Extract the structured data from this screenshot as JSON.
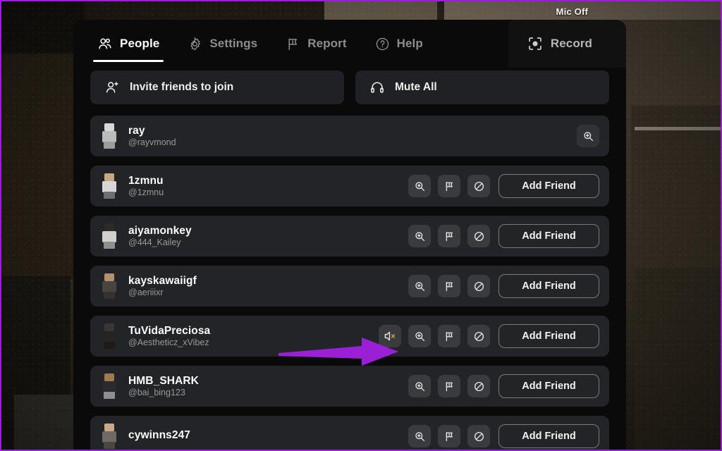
{
  "overlay": {
    "mic_status": "Mic Off",
    "annotation_arrow_color": "#9b1fd4",
    "border_color": "#9b1fd4"
  },
  "tabs": [
    {
      "label": "People",
      "icon": "people-icon",
      "active": true
    },
    {
      "label": "Settings",
      "icon": "gear-icon",
      "active": false
    },
    {
      "label": "Report",
      "icon": "flag-icon",
      "active": false
    },
    {
      "label": "Help",
      "icon": "question-icon",
      "active": false
    },
    {
      "label": "Record",
      "icon": "record-icon",
      "active": false
    }
  ],
  "actions": [
    {
      "label": "Invite friends to join",
      "icon": "person-add-icon"
    },
    {
      "label": "Mute All",
      "icon": "headset-icon"
    }
  ],
  "buttons": {
    "add_friend": "Add Friend"
  },
  "icons": {
    "inspect": "magnifier-plus-icon",
    "report": "flag-icon",
    "block": "block-icon",
    "mute": "speaker-mute-icon"
  },
  "players": [
    {
      "display_name": "ray",
      "username": "@rayvmond",
      "is_self": true,
      "has_mute": false,
      "has_add_friend": false,
      "avatar": {
        "head": "#d8d8d8",
        "body": "#b9bbbd",
        "legs": "#9a9c9e"
      }
    },
    {
      "display_name": "1zmnu",
      "username": "@1zmnu",
      "is_self": false,
      "has_mute": false,
      "has_add_friend": true,
      "avatar": {
        "head": "#c8a87c",
        "body": "#d6d6d6",
        "legs": "#6e6e6e"
      }
    },
    {
      "display_name": "aiyamonkey",
      "username": "@444_Kailey",
      "is_self": false,
      "has_mute": false,
      "has_add_friend": true,
      "avatar": {
        "head": "#2e2a26",
        "body": "#cfcfcf",
        "legs": "#8e8e8e"
      }
    },
    {
      "display_name": "kayskawaiigf",
      "username": "@aeriiixr",
      "is_self": false,
      "has_mute": false,
      "has_add_friend": true,
      "avatar": {
        "head": "#b59070",
        "body": "#4a4440",
        "legs": "#35312e"
      }
    },
    {
      "display_name": "TuVidaPreciosa",
      "username": "@Aestheticz_xVibez",
      "is_self": false,
      "has_mute": true,
      "has_add_friend": true,
      "avatar": {
        "head": "#3a3633",
        "body": "#262422",
        "legs": "#1d1b19"
      }
    },
    {
      "display_name": "HMB_SHARK",
      "username": "@bai_bing123",
      "is_self": false,
      "has_mute": false,
      "has_add_friend": true,
      "avatar": {
        "head": "#9e7a52",
        "body": "#2b2b2f",
        "legs": "#8e8e94"
      }
    },
    {
      "display_name": "cywinns247",
      "username": "",
      "is_self": false,
      "has_mute": false,
      "has_add_friend": true,
      "avatar": {
        "head": "#c9a988",
        "body": "#6f6a63",
        "legs": "#4a4743"
      }
    }
  ]
}
